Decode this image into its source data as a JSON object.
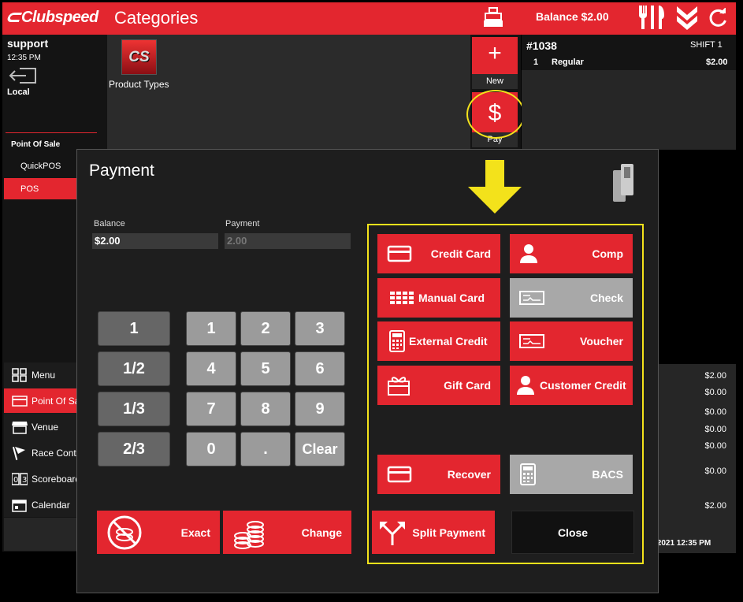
{
  "app": {
    "brand": "Clubspeed",
    "section_title": "Categories",
    "balance_label": "Balance $2.00"
  },
  "user": {
    "name": "support",
    "time": "12:35 PM",
    "location": "Local"
  },
  "sidebar": {
    "section_header": "Point Of Sale",
    "items": [
      {
        "label": "QuickPOS"
      },
      {
        "label": "POS"
      }
    ],
    "bottom_items": [
      {
        "label": "Menu",
        "icon": "grid-icon"
      },
      {
        "label": "Point Of Sale",
        "icon": "card-icon"
      },
      {
        "label": "Venue",
        "icon": "store-icon"
      },
      {
        "label": "Race Control",
        "icon": "flag-icon"
      },
      {
        "label": "Scoreboard",
        "icon": "scoreboard-icon"
      },
      {
        "label": "Calendar",
        "icon": "calendar-icon"
      }
    ]
  },
  "categories": {
    "tile_logo": "CS",
    "tile_label": "Product Types"
  },
  "actions": {
    "new_label": "New",
    "pay_label": "Pay"
  },
  "ticket": {
    "number": "#1038",
    "shift": "SHIFT 1",
    "line_qty": "1",
    "line_item": "Regular",
    "line_price": "$2.00",
    "totals": [
      "$2.00",
      "$0.00",
      "$0.00",
      "$0.00",
      "$0.00",
      "$0.00",
      "$2.00"
    ],
    "datetime": "/2021 12:35 PM"
  },
  "payment": {
    "title": "Payment",
    "balance_label": "Balance",
    "balance_value": "$2.00",
    "payment_label": "Payment",
    "payment_placeholder": "2.00",
    "fractions": [
      "1",
      "1/2",
      "1/3",
      "2/3"
    ],
    "keypad": [
      "1",
      "2",
      "3",
      "4",
      "5",
      "6",
      "7",
      "8",
      "9",
      "0",
      ".",
      "Clear"
    ],
    "exact_label": "Exact",
    "change_label": "Change",
    "methods": {
      "credit_card": "Credit Card",
      "comp": "Comp",
      "manual_card": "Manual Card",
      "check": "Check",
      "external_credit": "External Credit",
      "voucher": "Voucher",
      "gift_card": "Gift Card",
      "customer_credit": "Customer Credit",
      "recover": "Recover",
      "bacs": "BACS",
      "split_payment": "Split Payment",
      "close": "Close"
    }
  },
  "colors": {
    "brand_red": "#e3262f",
    "highlight_yellow": "#f3e21b",
    "disabled_gray": "#a8a8a8"
  }
}
